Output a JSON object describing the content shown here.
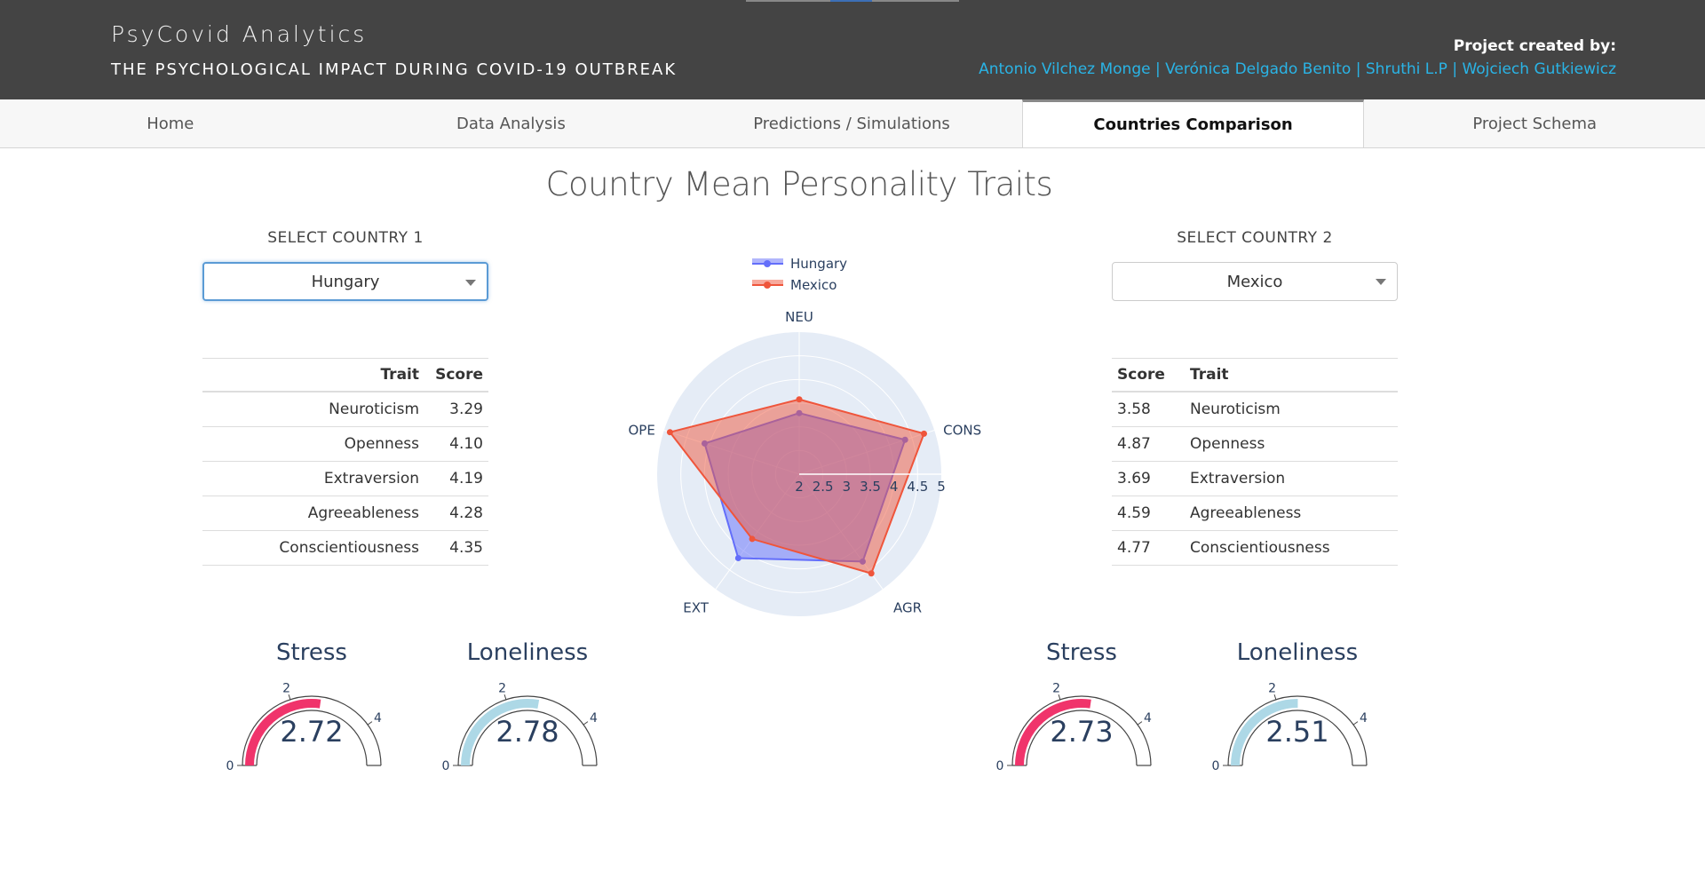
{
  "header": {
    "title": "PsyCovid Analytics",
    "subtitle": "THE PSYCHOLOGICAL IMPACT DURING COVID-19 OUTBREAK",
    "credit_label": "Project created by:",
    "authors": [
      "Antonio Vilchez Monge",
      "Verónica Delgado Benito",
      "Shruthi L.P",
      "Wojciech Gutkiewicz"
    ],
    "separator": " | "
  },
  "tabs": [
    "Home",
    "Data Analysis",
    "Predictions / Simulations",
    "Countries Comparison",
    "Project Schema"
  ],
  "active_tab": "Countries Comparison",
  "page_title": "Country Mean Personality Traits",
  "country1": {
    "label": "SELECT COUNTRY 1",
    "selected": "Hungary",
    "table_headers": [
      "Trait",
      "Score"
    ],
    "rows": [
      {
        "trait": "Neuroticism",
        "score": "3.29"
      },
      {
        "trait": "Openness",
        "score": "4.10"
      },
      {
        "trait": "Extraversion",
        "score": "4.19"
      },
      {
        "trait": "Agreeableness",
        "score": "4.28"
      },
      {
        "trait": "Conscientiousness",
        "score": "4.35"
      }
    ],
    "stress": {
      "title": "Stress",
      "value": "2.72"
    },
    "loneliness": {
      "title": "Loneliness",
      "value": "2.78"
    }
  },
  "country2": {
    "label": "SELECT COUNTRY 2",
    "selected": "Mexico",
    "table_headers": [
      "Score",
      "Trait"
    ],
    "rows": [
      {
        "trait": "Neuroticism",
        "score": "3.58"
      },
      {
        "trait": "Openness",
        "score": "4.87"
      },
      {
        "trait": "Extraversion",
        "score": "3.69"
      },
      {
        "trait": "Agreeableness",
        "score": "4.59"
      },
      {
        "trait": "Conscientiousness",
        "score": "4.77"
      }
    ],
    "stress": {
      "title": "Stress",
      "value": "2.73"
    },
    "loneliness": {
      "title": "Loneliness",
      "value": "2.51"
    }
  },
  "gauge_ticks": [
    "0",
    "2",
    "4"
  ],
  "colors": {
    "header_bg": "#444444",
    "link": "#2ab4e6",
    "hungary": "#636efa",
    "mexico": "#ef553b",
    "stress": "#f0346b",
    "loneliness": "#add8e6"
  },
  "chart_data": {
    "type": "radar",
    "axes": [
      "NEU",
      "CONS",
      "AGR",
      "EXT",
      "OPE"
    ],
    "radial_range": [
      2,
      5
    ],
    "radial_ticks": [
      "2",
      "2.5",
      "3",
      "3.5",
      "4",
      "4.5",
      "5"
    ],
    "legend_position": "top",
    "series": [
      {
        "name": "Hungary",
        "values": [
          3.29,
          4.35,
          4.28,
          4.19,
          4.1
        ]
      },
      {
        "name": "Mexico",
        "values": [
          3.58,
          4.77,
          4.59,
          3.69,
          4.87
        ]
      }
    ]
  }
}
